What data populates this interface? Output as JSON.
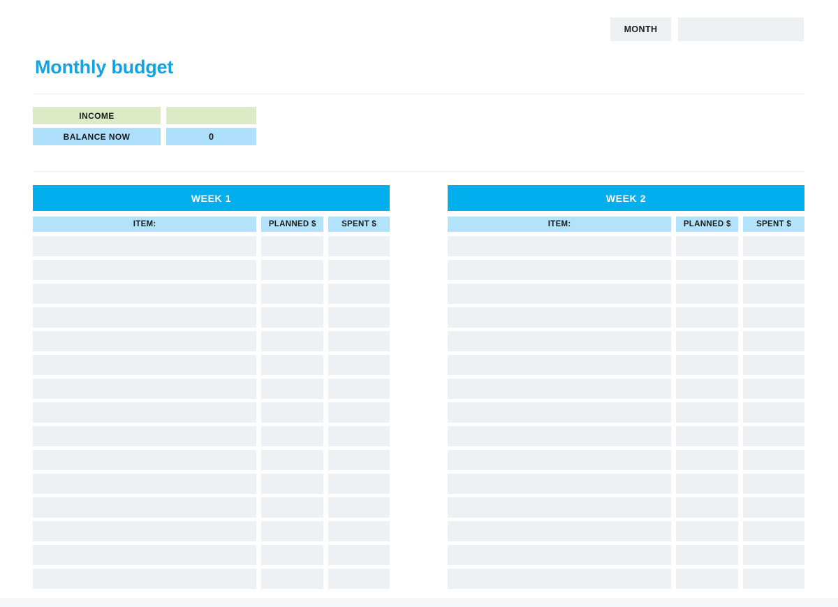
{
  "header": {
    "month_label": "MONTH",
    "month_value": "",
    "month_placeholder": ""
  },
  "title": "Monthly budget",
  "summary": [
    {
      "label": "INCOME",
      "value": "",
      "tone": "green"
    },
    {
      "label": "BALANCE NOW",
      "value": "0",
      "tone": "blue"
    }
  ],
  "columns": {
    "item": "ITEM:",
    "planned": "PLANNED $",
    "spent": "SPENT $"
  },
  "weeks": [
    {
      "title": "WEEK 1",
      "rows": [
        {
          "item": "",
          "planned": "",
          "spent": ""
        },
        {
          "item": "",
          "planned": "",
          "spent": ""
        },
        {
          "item": "",
          "planned": "",
          "spent": ""
        },
        {
          "item": "",
          "planned": "",
          "spent": ""
        },
        {
          "item": "",
          "planned": "",
          "spent": ""
        },
        {
          "item": "",
          "planned": "",
          "spent": ""
        },
        {
          "item": "",
          "planned": "",
          "spent": ""
        },
        {
          "item": "",
          "planned": "",
          "spent": ""
        },
        {
          "item": "",
          "planned": "",
          "spent": ""
        },
        {
          "item": "",
          "planned": "",
          "spent": ""
        },
        {
          "item": "",
          "planned": "",
          "spent": ""
        },
        {
          "item": "",
          "planned": "",
          "spent": ""
        },
        {
          "item": "",
          "planned": "",
          "spent": ""
        },
        {
          "item": "",
          "planned": "",
          "spent": ""
        },
        {
          "item": "",
          "planned": "",
          "spent": ""
        }
      ]
    },
    {
      "title": "WEEK 2",
      "rows": [
        {
          "item": "",
          "planned": "",
          "spent": ""
        },
        {
          "item": "",
          "planned": "",
          "spent": ""
        },
        {
          "item": "",
          "planned": "",
          "spent": ""
        },
        {
          "item": "",
          "planned": "",
          "spent": ""
        },
        {
          "item": "",
          "planned": "",
          "spent": ""
        },
        {
          "item": "",
          "planned": "",
          "spent": ""
        },
        {
          "item": "",
          "planned": "",
          "spent": ""
        },
        {
          "item": "",
          "planned": "",
          "spent": ""
        },
        {
          "item": "",
          "planned": "",
          "spent": ""
        },
        {
          "item": "",
          "planned": "",
          "spent": ""
        },
        {
          "item": "",
          "planned": "",
          "spent": ""
        },
        {
          "item": "",
          "planned": "",
          "spent": ""
        },
        {
          "item": "",
          "planned": "",
          "spent": ""
        },
        {
          "item": "",
          "planned": "",
          "spent": ""
        },
        {
          "item": "",
          "planned": "",
          "spent": ""
        }
      ]
    }
  ],
  "colors": {
    "accent_blue": "#03aeef",
    "title_blue": "#14a3e0",
    "header_blue": "#b3e3fb",
    "income_green": "#dcebc5",
    "balance_blue": "#aee0fb",
    "cell_gray": "#edf1f4"
  }
}
